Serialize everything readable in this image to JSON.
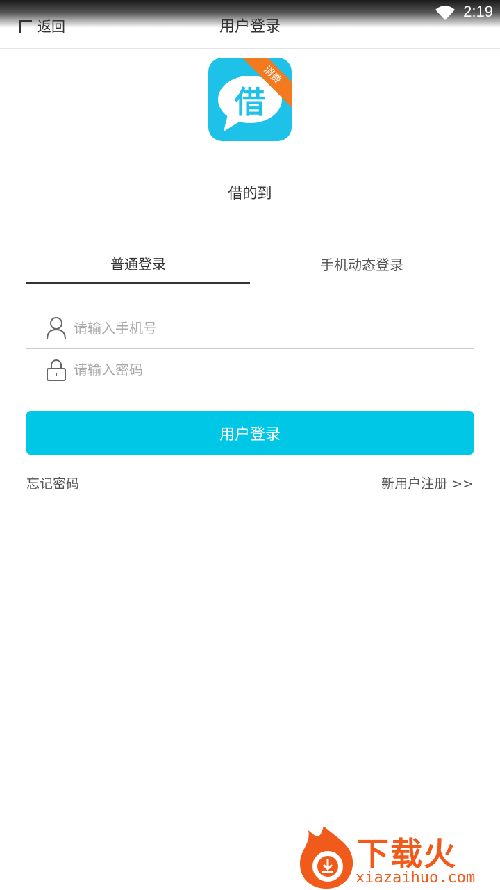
{
  "status_bar": {
    "time": "2:19",
    "wifi_icon": "wifi-icon"
  },
  "header": {
    "back_label": "返回",
    "title": "用户登录"
  },
  "logo": {
    "character": "借",
    "ribbon": "消费"
  },
  "app_name": "借的到",
  "tabs": [
    {
      "label": "普通登录",
      "active": true
    },
    {
      "label": "手机动态登录",
      "active": false
    }
  ],
  "form": {
    "phone_placeholder": "请输入手机号",
    "password_placeholder": "请输入密码",
    "submit_label": "用户登录"
  },
  "links": {
    "forgot": "忘记密码",
    "register": "新用户注册 >>"
  },
  "watermark": {
    "brand": "下载火",
    "url": "xiazaihuo.com"
  },
  "colors": {
    "accent": "#00c7e6",
    "logo_bg": "#1ec1e8",
    "ribbon": "#f47a20",
    "watermark": "#f05a1a"
  }
}
